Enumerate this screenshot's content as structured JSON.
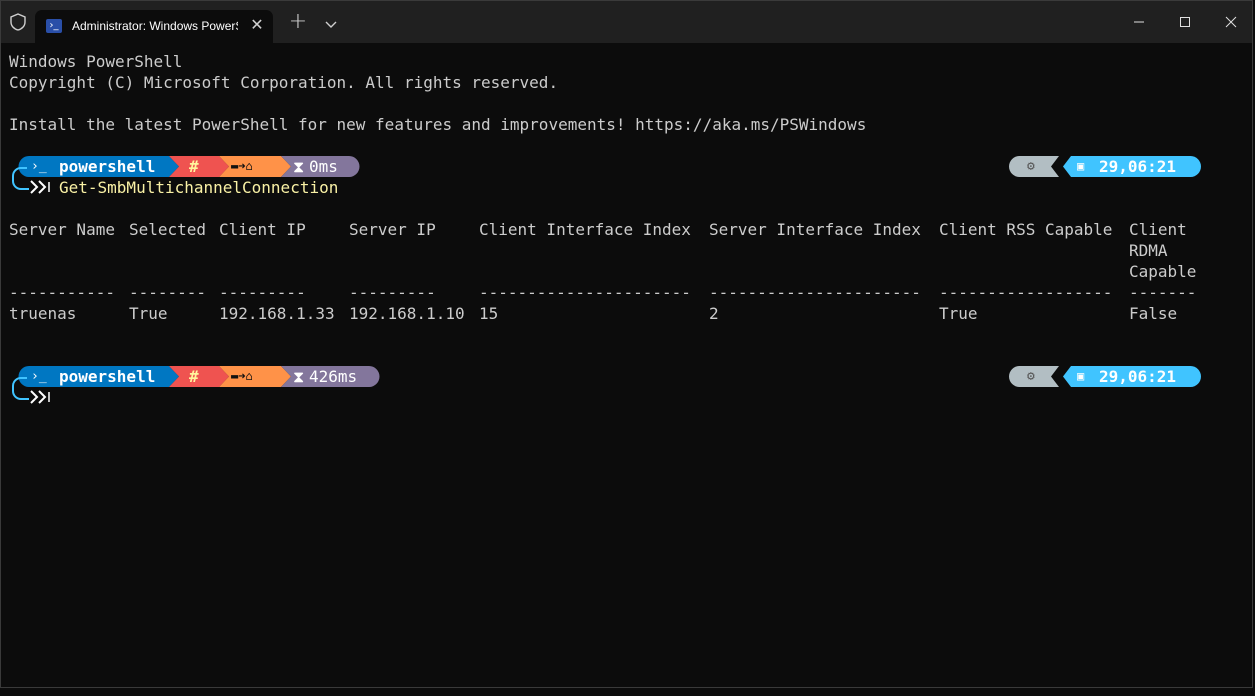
{
  "titlebar": {
    "tab_title": "Administrator: Windows PowerShell",
    "tab_close": "✕",
    "new_tab": "+",
    "colors": {
      "titlebar_bg": "#202020",
      "tab_bg": "#0c0c0c"
    }
  },
  "terminal": {
    "banner_line1": "Windows PowerShell",
    "banner_line2": "Copyright (C) Microsoft Corporation. All rights reserved.",
    "banner_line3": "Install the latest PowerShell for new features and improvements! https://aka.ms/PSWindows",
    "prompt1": {
      "shell": "powershell",
      "root": "#",
      "path_icon": "folder-home-icon",
      "duration": "0ms",
      "os_icon": "windows-gear-icon",
      "time": "29,06:21",
      "command": "Get-SmbMultichannelConnection"
    },
    "table": {
      "headers": [
        "Server Name",
        "Selected",
        "Client IP",
        "Server IP",
        "Client Interface Index",
        "Server Interface Index",
        "Client RSS Capable",
        "Client"
      ],
      "header_extra": [
        "RDMA",
        "Capable"
      ],
      "dashes": [
        "-----------",
        "--------",
        "---------",
        "---------",
        "----------------------",
        "----------------------",
        "------------------",
        "-------"
      ],
      "rows": [
        [
          "truenas",
          "True",
          "192.168.1.33",
          "192.168.1.10",
          "15",
          "2",
          "True",
          "False"
        ]
      ]
    },
    "prompt2": {
      "shell": "powershell",
      "root": "#",
      "duration": "426ms",
      "time": "29,06:21"
    },
    "colors": {
      "seg_shell": "#0077c2",
      "seg_root": "#ef5350",
      "seg_path": "#ff9248",
      "seg_time_exec": "#83769c",
      "seg_os": "#b2bec3",
      "seg_clock": "#40c4ff",
      "command": "#f9f1a5",
      "text": "#cccccc"
    }
  }
}
